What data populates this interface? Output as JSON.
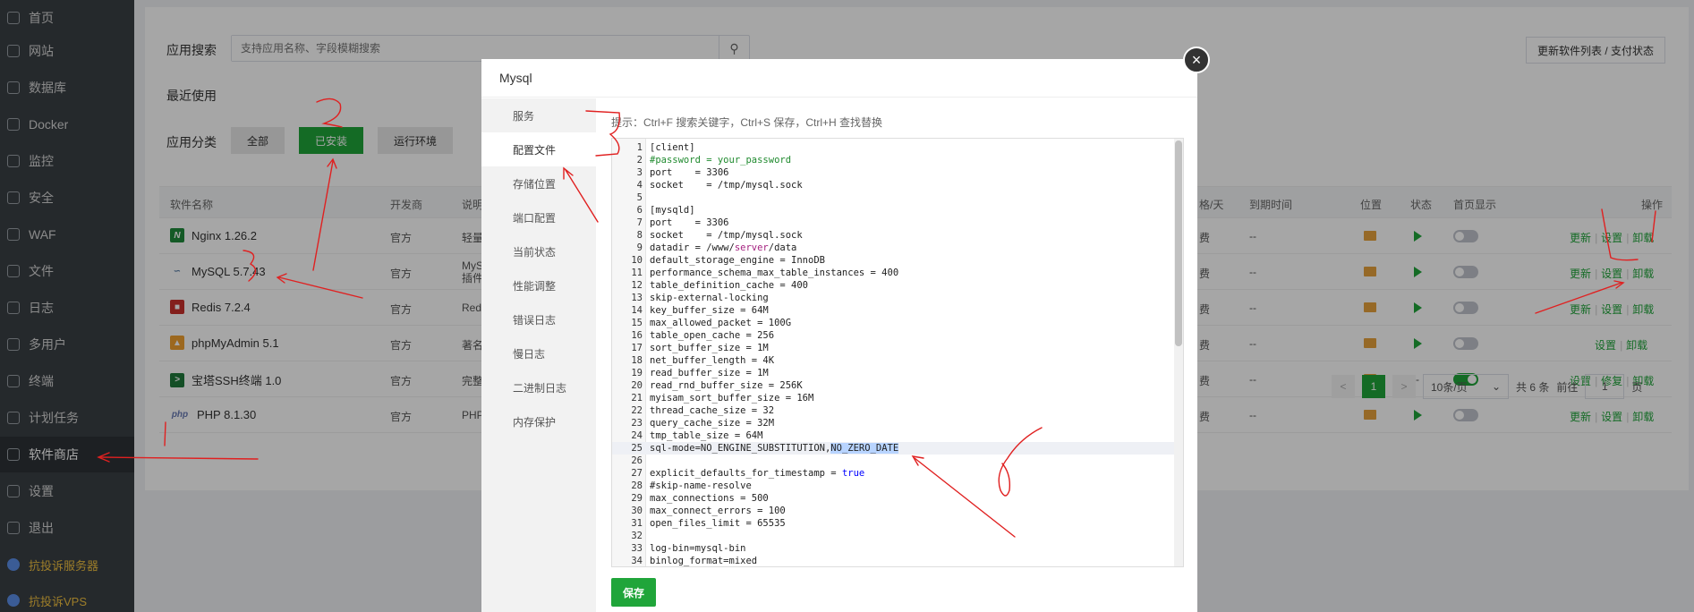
{
  "sidebar": {
    "items": [
      {
        "label": "首页"
      },
      {
        "label": "网站"
      },
      {
        "label": "数据库"
      },
      {
        "label": "Docker"
      },
      {
        "label": "监控"
      },
      {
        "label": "安全"
      },
      {
        "label": "WAF"
      },
      {
        "label": "文件"
      },
      {
        "label": "日志"
      },
      {
        "label": "多用户"
      },
      {
        "label": "终端"
      },
      {
        "label": "计划任务"
      },
      {
        "label": "软件商店"
      },
      {
        "label": "设置"
      },
      {
        "label": "退出"
      },
      {
        "label": "抗投诉服务器"
      },
      {
        "label": "抗投诉VPS"
      }
    ]
  },
  "main": {
    "search_label": "应用搜索",
    "search_placeholder": "支持应用名称、字段模糊搜索",
    "update_list_label": "更新软件列表 / 支付状态",
    "recent_label": "最近使用",
    "category_label": "应用分类",
    "categories": [
      {
        "label": "全部"
      },
      {
        "label": "已安装"
      },
      {
        "label": "运行环境"
      }
    ],
    "table_headers": {
      "name": "软件名称",
      "developer": "开发商",
      "desc": "说明",
      "price": "格/天",
      "expire": "到期时间",
      "location": "位置",
      "status": "状态",
      "home_display": "首页显示",
      "ops": "操作"
    },
    "rows": [
      {
        "name": "Nginx 1.26.2",
        "developer": "官方",
        "desc": "轻量",
        "price": "费",
        "expire": "--",
        "ops": [
          "更新",
          "设置",
          "卸载"
        ]
      },
      {
        "name": "MySQL 5.7.43",
        "developer": "官方",
        "desc": "MySQL",
        "desc2": "插件",
        "price": "费",
        "expire": "--",
        "ops": [
          "更新",
          "设置",
          "卸载"
        ]
      },
      {
        "name": "Redis 7.2.4",
        "developer": "官方",
        "desc": "Redi",
        "price": "费",
        "expire": "--",
        "ops": [
          "更新",
          "设置",
          "卸载"
        ]
      },
      {
        "name": "phpMyAdmin 5.1",
        "developer": "官方",
        "desc": "著名",
        "price": "费",
        "expire": "--",
        "ops": [
          "设置",
          "卸载"
        ]
      },
      {
        "name": "宝塔SSH终端 1.0",
        "developer": "官方",
        "desc": "完整",
        "price": "费",
        "expire": "--",
        "status": "--",
        "ops": [
          "设置",
          "修复",
          "卸载"
        ]
      },
      {
        "name": "PHP 8.1.30",
        "developer": "官方",
        "desc": "PHP",
        "price": "费",
        "expire": "--",
        "ops": [
          "更新",
          "设置",
          "卸载"
        ]
      }
    ],
    "pager": {
      "prev": "<",
      "current": "1",
      "next": ">",
      "page_size": "10条/页",
      "total": "共 6 条",
      "goto_label": "前往",
      "goto_value": "1",
      "page_suffix": "页"
    }
  },
  "modal": {
    "title": "Mysql",
    "close": "×",
    "nav": [
      {
        "label": "服务"
      },
      {
        "label": "配置文件"
      },
      {
        "label": "存储位置"
      },
      {
        "label": "端口配置"
      },
      {
        "label": "当前状态"
      },
      {
        "label": "性能调整"
      },
      {
        "label": "错误日志"
      },
      {
        "label": "慢日志"
      },
      {
        "label": "二进制日志"
      },
      {
        "label": "内存保护"
      }
    ],
    "tip": "提示：Ctrl+F 搜索关键字，Ctrl+S 保存，Ctrl+H 查找替换",
    "save_label": "保存",
    "code_lines": [
      "[client]",
      "#password = your_password",
      "port\t= 3306",
      "socket\t= /tmp/mysql.sock",
      "",
      "[mysqld]",
      "port\t= 3306",
      "socket\t= /tmp/mysql.sock",
      "datadir = /www/server/data",
      "default_storage_engine = InnoDB",
      "performance_schema_max_table_instances = 400",
      "table_definition_cache = 400",
      "skip-external-locking",
      "key_buffer_size = 64M",
      "max_allowed_packet = 100G",
      "table_open_cache = 256",
      "sort_buffer_size = 1M",
      "net_buffer_length = 4K",
      "read_buffer_size = 1M",
      "read_rnd_buffer_size = 256K",
      "myisam_sort_buffer_size = 16M",
      "thread_cache_size = 32",
      "query_cache_size = 32M",
      "tmp_table_size = 64M",
      "sql-mode=NO_ENGINE_SUBSTITUTION,NO_ZERO_DATE",
      "",
      "explicit_defaults_for_timestamp = true",
      "#skip-name-resolve",
      "max_connections = 500",
      "max_connect_errors = 100",
      "open_files_limit = 65535",
      "",
      "log-bin=mysql-bin",
      "binlog_format=mixed"
    ]
  },
  "colors": {
    "accent": "#20a53a",
    "annotation": "#e02020",
    "sidebar_bg": "#3a3f44"
  }
}
